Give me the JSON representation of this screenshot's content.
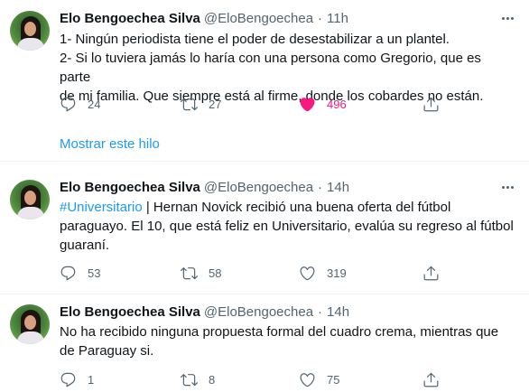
{
  "tweets": [
    {
      "name": "Elo Bengoechea Silva",
      "handle": "@EloBengoechea",
      "separator": "·",
      "time": "11h",
      "text_lines": [
        "1- Ningún periodista tiene el poder de desestabilizar a un plantel.",
        "2- Si lo tuviera jamás lo haría con una persona como Gregorio, que es parte",
        "de mi familia. Que siempre está al firme, donde los cobardes no están."
      ],
      "replies": "24",
      "retweets": "27",
      "likes": "496",
      "liked": true,
      "show_thread": "Mostrar este hilo"
    },
    {
      "name": "Elo Bengoechea Silva",
      "handle": "@EloBengoechea",
      "separator": "·",
      "time": "14h",
      "hashtag": "#Universitario",
      "text_first_rest": " | Hernan Novick recibió una buena oferta del fútbol",
      "text_lines": [
        "paraguayo. El 10, que está feliz en Universitario, evalúa su regreso al fútbol",
        "guaraní."
      ],
      "replies": "53",
      "retweets": "58",
      "likes": "319",
      "liked": false
    },
    {
      "name": "Elo Bengoechea Silva",
      "handle": "@EloBengoechea",
      "separator": "·",
      "time": "14h",
      "text_lines": [
        "No ha recibido ninguna propuesta formal del cuadro crema, mientras que",
        "de Paraguay si."
      ],
      "replies": "1",
      "retweets": "8",
      "likes": "75",
      "liked": false
    }
  ],
  "colors": {
    "link": "#1d9bf0",
    "like_active": "#f91880",
    "secondary_text": "#536471",
    "divider": "#eff3f4"
  },
  "icons": [
    "reply-icon",
    "retweet-icon",
    "like-icon",
    "share-icon",
    "more-icon"
  ]
}
